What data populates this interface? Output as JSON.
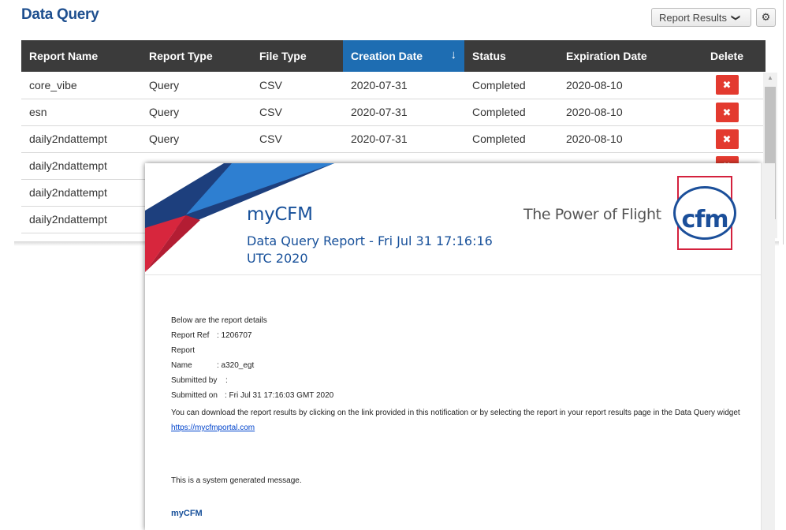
{
  "widget": {
    "title": "Data Query",
    "report_results_label": "Report Results",
    "chevron": "❯",
    "gear": "⚙"
  },
  "table": {
    "columns": [
      "Report Name",
      "Report Type",
      "File Type",
      "Creation Date",
      "Status",
      "Expiration Date",
      "Delete"
    ],
    "sort_arrow": "↓",
    "delete_glyph": "✖",
    "rows": [
      {
        "name": "core_vibe",
        "type": "Query",
        "file": "CSV",
        "created": "2020-07-31",
        "status": "Completed",
        "expires": "2020-08-10"
      },
      {
        "name": "esn",
        "type": "Query",
        "file": "CSV",
        "created": "2020-07-31",
        "status": "Completed",
        "expires": "2020-08-10"
      },
      {
        "name": "daily2ndattempt",
        "type": "Query",
        "file": "CSV",
        "created": "2020-07-31",
        "status": "Completed",
        "expires": "2020-08-10"
      },
      {
        "name": "daily2ndattempt",
        "type": "",
        "file": "",
        "created": "",
        "status": "",
        "expires": ""
      },
      {
        "name": "daily2ndattempt",
        "type": "",
        "file": "",
        "created": "",
        "status": "",
        "expires": ""
      },
      {
        "name": "daily2ndattempt",
        "type": "",
        "file": "",
        "created": "",
        "status": "",
        "expires": ""
      }
    ]
  },
  "email": {
    "brand": "myCFM",
    "subtitle": "Data Query Report - Fri Jul 31 17:16:16 UTC 2020",
    "tagline": "The Power of Flight",
    "logo_text": "cfm",
    "intro": "Below are the report details",
    "report_ref_label": "Report Ref",
    "report_ref_value": ": 1206707",
    "report_name_label": "Report Name",
    "report_name_value": ": a320_egt",
    "submitted_by_label": "Submitted by",
    "submitted_by_value": ":",
    "submitted_on_label": "Submitted on",
    "submitted_on_value": ": Fri Jul 31 17:16:03 GMT 2020",
    "download_text": "You can download the report results by clicking on the link provided in this notification or by selecting the report in your report results page in the Data Query widget",
    "link": "https://mycfmportal.com",
    "system_message": "This is a system generated message.",
    "footer_brand": "myCFM"
  },
  "colors": {
    "title_blue": "#1e4f8f",
    "header_dark": "#3b3b3b",
    "sorted_header": "#1e6db2",
    "delete_red": "#e33a2f",
    "logo_red": "#d4213d",
    "logo_blue": "#1b4f9a"
  }
}
